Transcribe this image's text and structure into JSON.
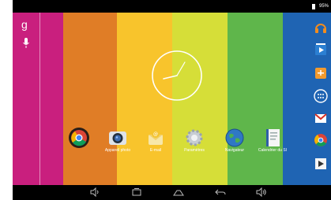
{
  "status_bar": {
    "battery_text": "95%"
  },
  "wallpaper": {
    "stripe_colors": [
      "#c91f7e",
      "#e07d26",
      "#f8c42c",
      "#d6de38",
      "#5fb64b",
      "#1f64b3"
    ]
  },
  "search": {
    "google_letter": "g",
    "mic_icon": "mic-icon"
  },
  "clock": {
    "hour_hand": "10",
    "minute_hand": "8"
  },
  "dock": {
    "apps": [
      {
        "label": "",
        "icon": "chrome-icon"
      },
      {
        "label": "Appareil photo",
        "icon": "camera-icon"
      },
      {
        "label": "E-mail",
        "icon": "email-icon"
      },
      {
        "label": "Paramètres",
        "icon": "settings-icon"
      },
      {
        "label": "Navigateur",
        "icon": "browser-icon"
      },
      {
        "label": "Calendrier du SI",
        "icon": "notebook-icon"
      }
    ]
  },
  "right_panel": {
    "icons": [
      "headphones-icon",
      "play-store-icon",
      "calculator-icon",
      "apps-grid-icon",
      "gmail-icon",
      "chrome-icon",
      "play-icon"
    ]
  },
  "nav_bar": {
    "buttons": [
      "volume-down-icon",
      "recent-apps-icon",
      "home-icon",
      "back-icon",
      "volume-up-icon"
    ]
  }
}
